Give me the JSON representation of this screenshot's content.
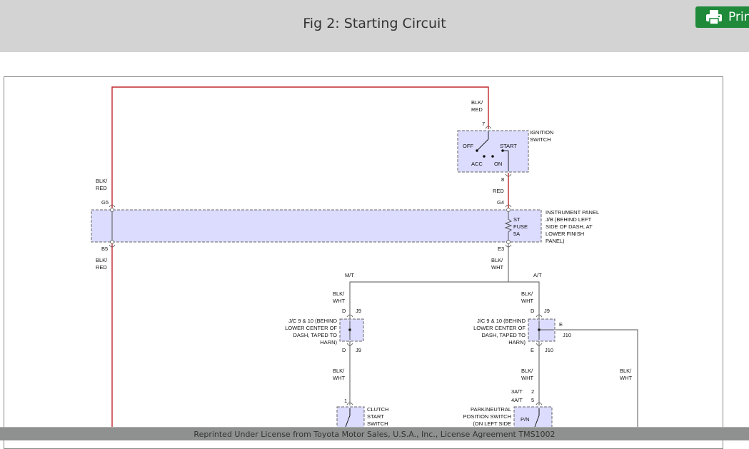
{
  "header": {
    "title": "Fig 2: Starting Circuit",
    "print_label": "Print"
  },
  "footer": {
    "text": "Reprinted Under License from Toyota Motor Sales, U.S.A., Inc., License Agreement TMS1002"
  },
  "colors": {
    "header_bg": "#d3d3d3",
    "print_button": "#1e8a3a",
    "component_fill": "#dcdcff",
    "power_wire": "#c0282d",
    "wire": "#555555"
  },
  "diagram": {
    "wire_blk_red": "BLK/RED",
    "wire_blk_red_top": "BLK/RED",
    "wire_red": "RED",
    "wire_blk_wht": "BLK/WHT",
    "ignition_switch": {
      "pin_in": "7",
      "pin_out": "8",
      "name": "IGNITION SWITCH",
      "off": "OFF",
      "start": "START",
      "acc": "ACC",
      "on": "ON"
    },
    "instrument_panel": {
      "pin_g5": "G5",
      "pin_g4": "G4",
      "pin_b5": "B5",
      "pin_e3": "E3",
      "fuse_st": "ST",
      "fuse_label": "FUSE",
      "fuse_rating": "5A",
      "name": "INSTRUMENT PANEL J/B (BEHIND LEFT SIDE OF DASH, AT LOWER FINISH PANEL)"
    },
    "branch_mt": "M/T",
    "branch_at": "A/T",
    "jc_left": {
      "name": "J/C 9 & 10 (BEHIND LOWER CENTER OF DASH, TAPED TO HARN)",
      "pin_top": "D",
      "conn_top": "J9",
      "pin_bottom": "D",
      "conn_bottom": "J9"
    },
    "jc_right": {
      "name": "J/C 9 & 10 (BEHIND LOWER CENTER OF DASH, TAPED TO HARN)",
      "pin_top": "D",
      "conn_top": "J9",
      "pin_side": "E",
      "conn_side": "J10",
      "pin_bottom": "E",
      "conn_bottom": "J10"
    },
    "clutch_switch": {
      "pin": "1",
      "name": "CLUTCH START SWITCH"
    },
    "park_neutral": {
      "pin_3at": "3A/T",
      "pin_3at_num": "2",
      "pin_4at": "4A/T",
      "pin_4at_num": "5",
      "name": "PARK/NEUTRAL POSITION SWITCH (ON LEFT SIDE",
      "pn": "P/N"
    }
  }
}
